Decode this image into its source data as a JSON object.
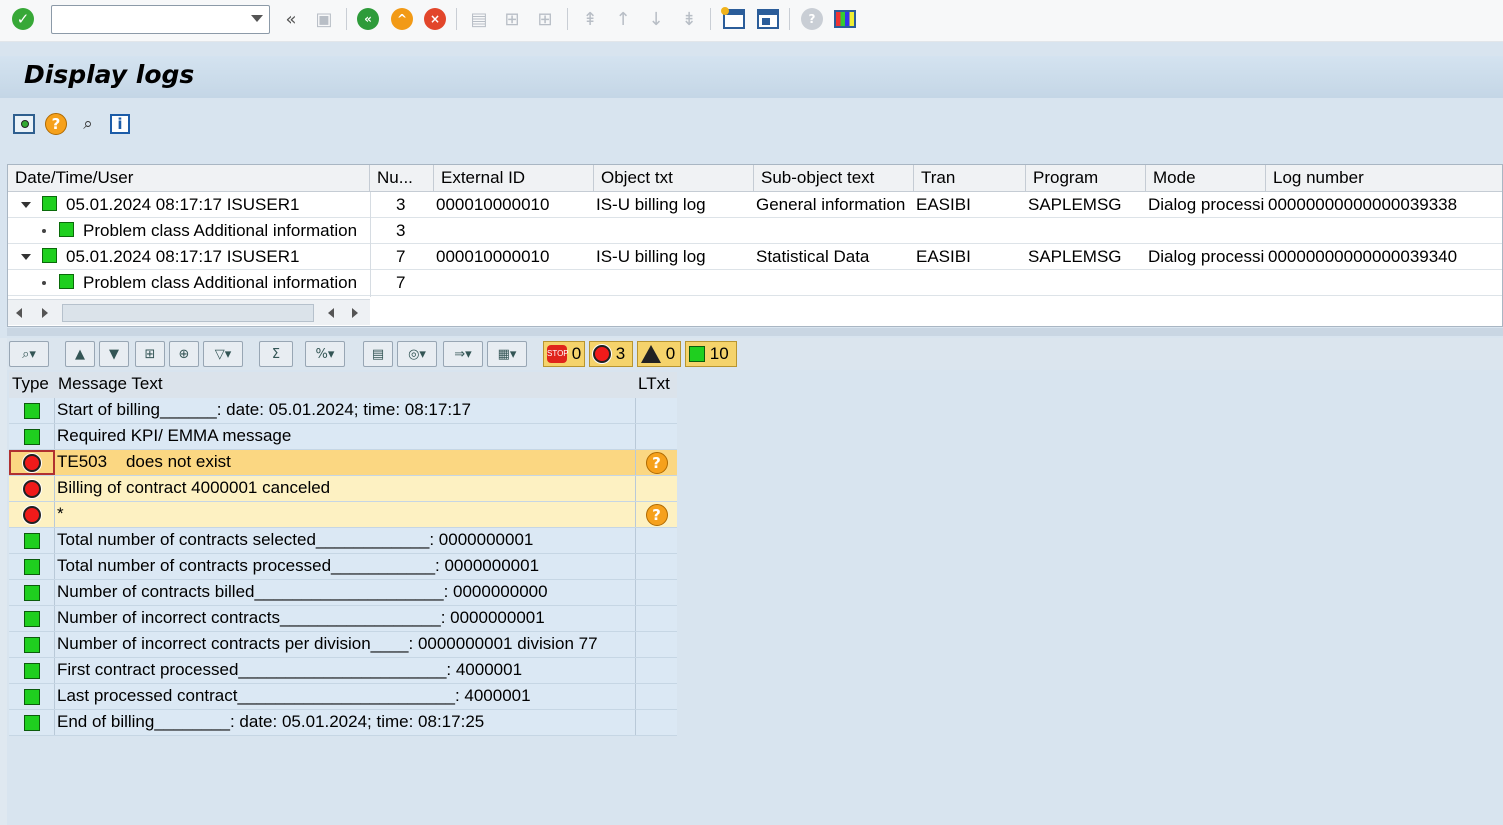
{
  "system_toolbar": {
    "command_field": "",
    "icons": [
      "enter-icon",
      "back-icon",
      "exit-icon",
      "cancel-icon",
      "save-icon",
      "print-icon",
      "find-icon",
      "find-next-icon",
      "first-page-icon",
      "previous-page-icon",
      "next-page-icon",
      "last-page-icon",
      "new-session-icon",
      "shortcut-icon",
      "help-icon",
      "customize-icon"
    ]
  },
  "title": "Display logs",
  "app_toolbar_icons": [
    "display-message-icon",
    "help-icon",
    "glasses-icon",
    "info-icon"
  ],
  "top_grid": {
    "columns": [
      "Date/Time/User",
      "Nu...",
      "External ID",
      "Object txt",
      "Sub-object text",
      "Tran",
      "Program",
      "Mode",
      "Log number"
    ],
    "rows": [
      {
        "level": 0,
        "datetime": "05.01.2024  08:17:17  ISUSER1",
        "num": "3",
        "ext_id": "000010000010",
        "object": "IS-U billing log",
        "subobject": "General information",
        "tran": "EASIBI",
        "program": "SAPLEMSG",
        "mode": "Dialog processi",
        "log": "00000000000000039338"
      },
      {
        "level": 1,
        "datetime": "Problem class Additional information",
        "num": "3",
        "ext_id": "",
        "object": "",
        "subobject": "",
        "tran": "",
        "program": "",
        "mode": "",
        "log": ""
      },
      {
        "level": 0,
        "datetime": "05.01.2024  08:17:17  ISUSER1",
        "num": "7",
        "ext_id": "000010000010",
        "object": "IS-U billing log",
        "subobject": "Statistical Data",
        "tran": "EASIBI",
        "program": "SAPLEMSG",
        "mode": "Dialog processi",
        "log": "00000000000000039340"
      },
      {
        "level": 1,
        "datetime": "Problem class Additional information",
        "num": "7",
        "ext_id": "",
        "object": "",
        "subobject": "",
        "tran": "",
        "program": "",
        "mode": "",
        "log": ""
      }
    ]
  },
  "counters": {
    "stop": "0",
    "error": "3",
    "warning": "0",
    "success": "10"
  },
  "message_list": {
    "columns": [
      "Type",
      "Message Text",
      "LTxt"
    ],
    "rows": [
      {
        "type": "success",
        "text": "Start of billing______: date: 05.01.2024; time: 08:17:17",
        "ltxt": false,
        "state": "ok"
      },
      {
        "type": "success",
        "text": "Required KPI/ EMMA message",
        "ltxt": false,
        "state": "ok"
      },
      {
        "type": "error",
        "text": "TE503    does not exist",
        "ltxt": true,
        "state": "sel"
      },
      {
        "type": "error",
        "text": "Billing of contract 4000001 canceled",
        "ltxt": false,
        "state": "err"
      },
      {
        "type": "error",
        "text": "*",
        "ltxt": true,
        "state": "err"
      },
      {
        "type": "success",
        "text": "Total number of contracts selected____________: 0000000001",
        "ltxt": false,
        "state": "ok"
      },
      {
        "type": "success",
        "text": "Total number of contracts processed___________: 0000000001",
        "ltxt": false,
        "state": "ok"
      },
      {
        "type": "success",
        "text": "Number of contracts billed____________________: 0000000000",
        "ltxt": false,
        "state": "ok"
      },
      {
        "type": "success",
        "text": "Number of incorrect contracts_________________: 0000000001",
        "ltxt": false,
        "state": "ok"
      },
      {
        "type": "success",
        "text": "Number of incorrect contracts per division____: 0000000001 division 77",
        "ltxt": false,
        "state": "ok"
      },
      {
        "type": "success",
        "text": "First contract processed______________________: 4000001",
        "ltxt": false,
        "state": "ok"
      },
      {
        "type": "success",
        "text": "Last processed contract_______________________: 4000001",
        "ltxt": false,
        "state": "ok"
      },
      {
        "type": "success",
        "text": "End of billing________: date: 05.01.2024; time: 08:17:25",
        "ltxt": false,
        "state": "ok"
      }
    ]
  }
}
